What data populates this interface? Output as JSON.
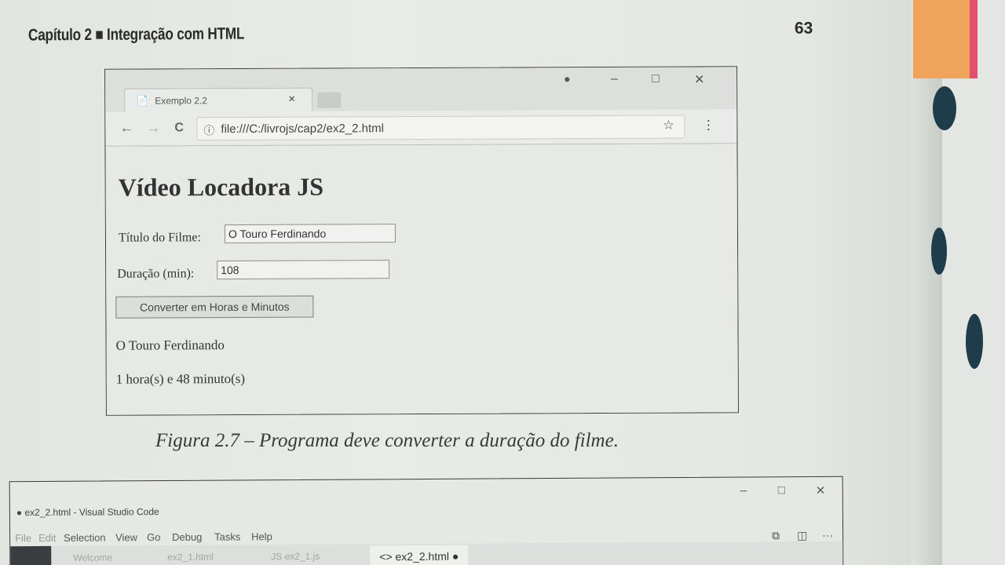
{
  "book": {
    "chapter_header": "Capítulo 2 ■ Integração com HTML",
    "page_number": "63",
    "figure_caption": "Figura 2.7 – Programa deve converter a duração do filme."
  },
  "browser": {
    "tab_title": "Exemplo 2.2",
    "tab_close": "×",
    "url": "file:///C:/livrojs/cap2/ex2_2.html",
    "icons": {
      "page": "📄",
      "back": "←",
      "forward": "→",
      "reload": "C",
      "info": "ⓘ",
      "star": "☆",
      "menu": "⋮",
      "profile": "●",
      "minimize": "–",
      "maximize": "□",
      "close": "✕"
    },
    "page": {
      "heading": "Vídeo Locadora JS",
      "title_label": "Título do Filme:",
      "title_value": "O Touro Ferdinando",
      "duration_label": "Duração (min):",
      "duration_value": "108",
      "convert_button": "Converter em Horas e Minutos",
      "output_title": "O Touro Ferdinando",
      "output_duration": "1 hora(s) e 48 minuto(s)"
    }
  },
  "vscode": {
    "window_title": "● ex2_2.html - Visual Studio Code",
    "menu": [
      "File",
      "Edit",
      "Selection",
      "View",
      "Go",
      "Debug",
      "Tasks",
      "Help"
    ],
    "tabs": [
      {
        "label": "Welcome"
      },
      {
        "label": "ex2_1.html"
      },
      {
        "label": "JS ex2_1.js"
      }
    ],
    "active_tab": "<> ex2_2.html ●",
    "controls": {
      "minimize": "–",
      "maximize": "□",
      "close": "✕"
    },
    "right_icons": {
      "split": "⧉",
      "layout": "◫",
      "more": "···"
    }
  }
}
